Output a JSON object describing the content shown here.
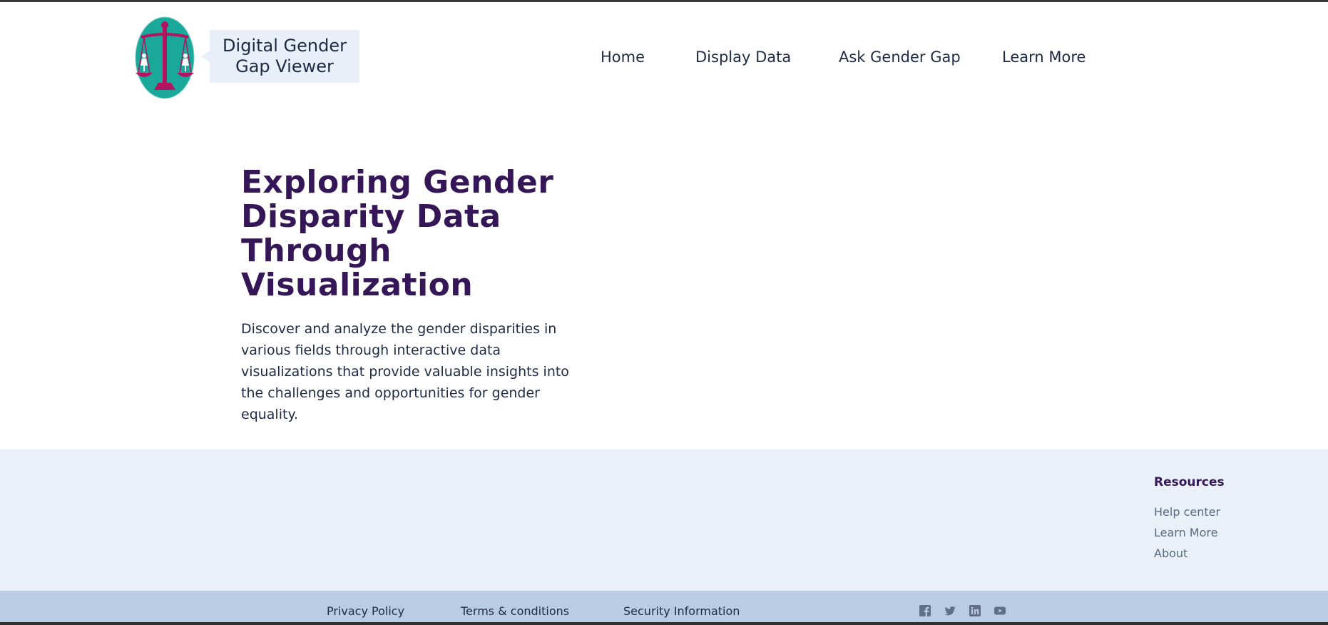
{
  "header": {
    "logo_label_line1": "Digital Gender",
    "logo_label_line2": "Gap Viewer",
    "nav": [
      "Home",
      "Display Data",
      "Ask Gender Gap",
      "Learn More"
    ]
  },
  "hero": {
    "title_lines": [
      "Exploring Gender",
      "Disparity Data",
      "Through",
      "Visualization"
    ],
    "description": "Discover and analyze the gender disparities in various fields through interactive data visualizations that provide valuable insights into the challenges and opportunities for gender equality."
  },
  "footer": {
    "resources_heading": "Resources",
    "resources_links": [
      "Help center",
      "Learn More",
      "About"
    ],
    "legal_links": [
      "Privacy Policy",
      "Terms & conditions",
      "Security Information"
    ],
    "social_icons": [
      "facebook-icon",
      "twitter-icon",
      "linkedin-icon",
      "youtube-icon"
    ]
  },
  "colors": {
    "brand_purple": "#351757",
    "logo_teal": "#1aa89a",
    "logo_magenta": "#b3135f",
    "footer_light": "#e9f0f8",
    "footer_dark": "#b8cce4"
  }
}
